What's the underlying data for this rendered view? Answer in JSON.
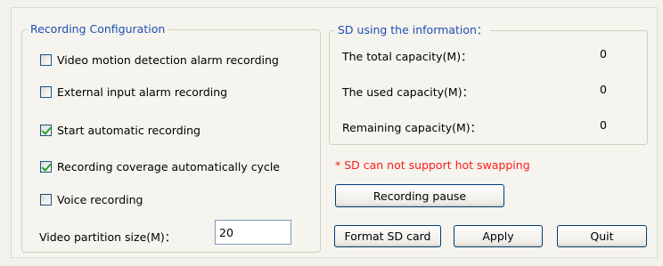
{
  "recording_config": {
    "title": "Recording  Configuration",
    "options": [
      {
        "label": "Video motion detection alarm recording",
        "checked": false
      },
      {
        "label": "External input alarm recording",
        "checked": false
      },
      {
        "label": "Start automatic recording",
        "checked": true
      },
      {
        "label": "Recording coverage automatically cycle",
        "checked": true
      },
      {
        "label": "Voice recording",
        "checked": false
      }
    ],
    "partition_label": "Video partition size(M)：",
    "partition_value": "20"
  },
  "sd_info": {
    "title": "SD using the information：",
    "rows": [
      {
        "label": "The total capacity(M)：",
        "value": "0"
      },
      {
        "label": "The used capacity(M)：",
        "value": "0"
      },
      {
        "label": "Remaining capacity(M)：",
        "value": "0"
      }
    ]
  },
  "warning": "* SD can not support hot swapping",
  "buttons": {
    "recording_pause": "Recording pause",
    "format_sd": "Format SD card",
    "apply": "Apply",
    "quit": "Quit"
  }
}
